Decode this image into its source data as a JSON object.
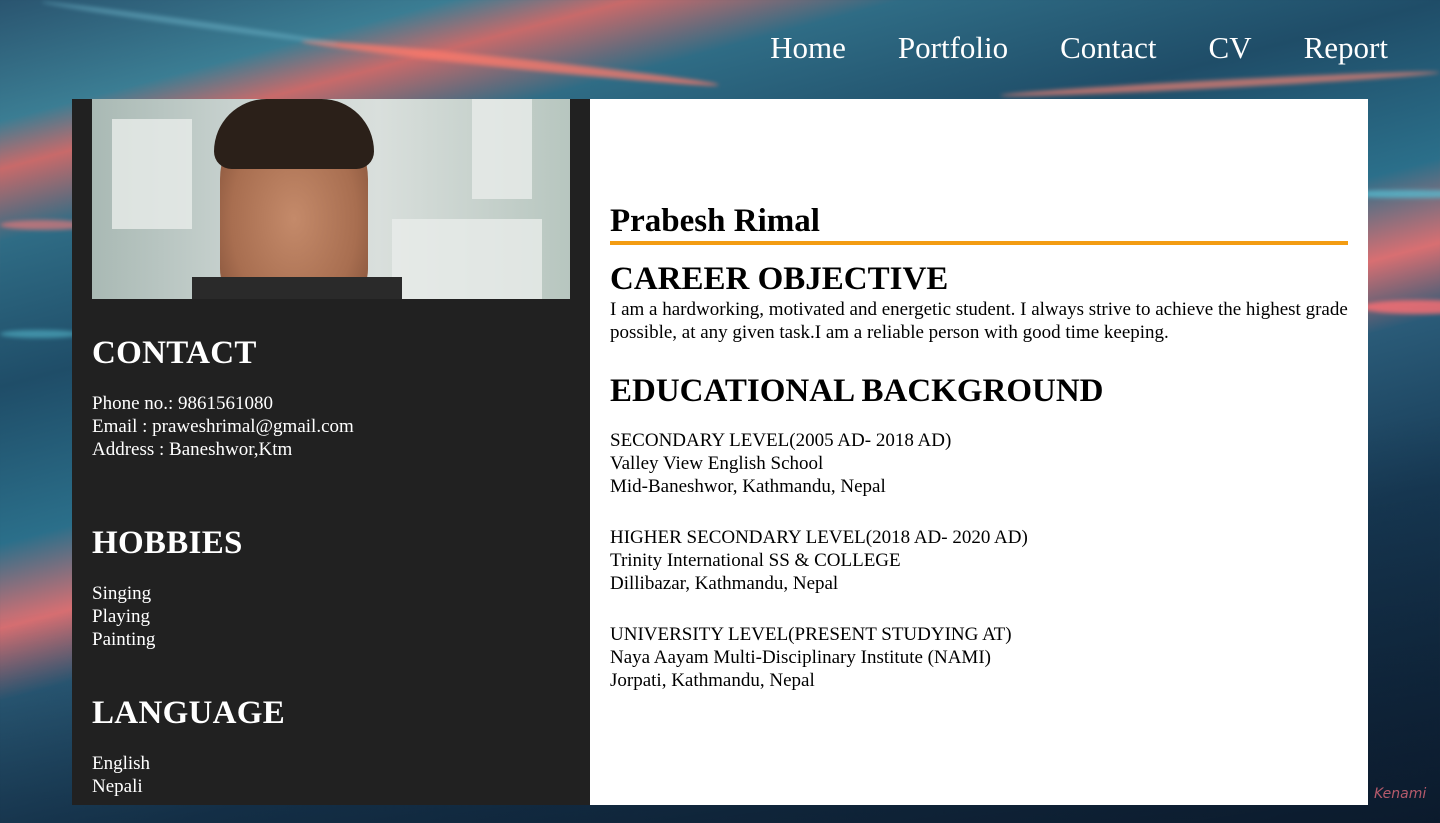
{
  "nav": {
    "items": [
      "Home",
      "Portfolio",
      "Contact",
      "CV",
      "Report"
    ]
  },
  "sidebar": {
    "contact": {
      "title": "CONTACT",
      "phone": "Phone no.: 9861561080",
      "email": "Email : praweshrimal@gmail.com",
      "address": "Address : Baneshwor,Ktm"
    },
    "hobbies": {
      "title": "HOBBIES",
      "items": [
        "Singing",
        "Playing",
        "Painting"
      ]
    },
    "language": {
      "title": "LANGUAGE",
      "items": [
        "English",
        "Nepali"
      ]
    }
  },
  "main": {
    "name": "Prabesh Rimal",
    "career_objective": {
      "title": "CAREER OBJECTIVE",
      "text": "I am a hardworking, motivated and energetic student. I always strive to achieve the highest grade possible, at any given task.I am a reliable person with good time keeping."
    },
    "education": {
      "title": "EDUCATIONAL BACKGROUND",
      "entries": [
        {
          "level": "SECONDARY LEVEL(2005 AD- 2018 AD)",
          "school": "Valley View English School",
          "location": "Mid-Baneshwor, Kathmandu, Nepal"
        },
        {
          "level": "HIGHER SECONDARY LEVEL(2018 AD- 2020 AD)",
          "school": "Trinity International SS & COLLEGE",
          "location": "Dillibazar, Kathmandu, Nepal"
        },
        {
          "level": "UNIVERSITY LEVEL(PRESENT STUDYING AT)",
          "school": "Naya Aayam Multi-Disciplinary Institute (NAMI)",
          "location": "Jorpati, Kathmandu, Nepal"
        }
      ]
    }
  },
  "background": {
    "signature": "Kenami"
  },
  "colors": {
    "accent_rule": "#f39c12",
    "sidebar_bg": "#212121",
    "main_bg": "#ffffff"
  }
}
